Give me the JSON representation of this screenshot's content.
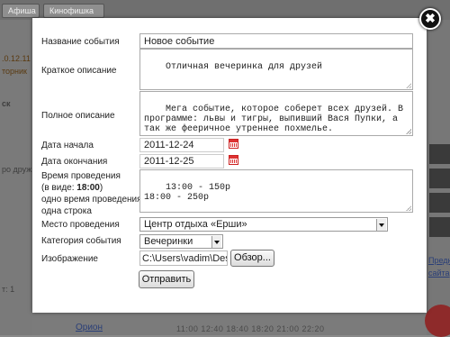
{
  "background": {
    "topbar_buttons": [
      "Афиша",
      "Кинофишка"
    ],
    "left_date": ".0.12.11",
    "left_day": "торник",
    "left_fragment": "ск",
    "left_friends": "ро друж",
    "left_count": "т: 1",
    "right_links": [
      "Предн",
      "сайта"
    ],
    "bottom_link": "Орион",
    "bottom_times": "11:00  12:40  18:40  18:20  21:00  22:20"
  },
  "modal": {
    "close_glyph": "✖",
    "fields": {
      "event_name": {
        "label": "Название события",
        "value": "Новое событие"
      },
      "short_desc": {
        "label": "Краткое описание",
        "value": "Отличная вечеринка для друзей"
      },
      "full_desc": {
        "label": "Полное описание",
        "value": "Мега событие, которое соберет всех друзей. В программе: львы и тигры, выпивший Вася Пупки, а так же фееричное утреннее похмелье."
      },
      "start_date": {
        "label": "Дата начала",
        "value": "2011-12-24"
      },
      "end_date": {
        "label": "Дата окончания",
        "value": "2011-12-25"
      },
      "time": {
        "label_line1": "Время проведения",
        "label_line2_prefix": "(в виде: ",
        "label_line2_bold": "18:00",
        "label_line2_suffix": ")",
        "label_line3": "одно время проведения -",
        "label_line4": "одна строка",
        "value": "13:00 - 150р\n18:00 - 250р"
      },
      "venue": {
        "label": "Место проведения",
        "value": "Центр отдыха «Ерши»"
      },
      "category": {
        "label": "Категория события",
        "value": "Вечеринки"
      },
      "image": {
        "label": "Изображение",
        "value": "C:\\Users\\vadim\\Deskt",
        "browse_label": "Обзор..."
      }
    },
    "submit_label": "Отправить"
  }
}
